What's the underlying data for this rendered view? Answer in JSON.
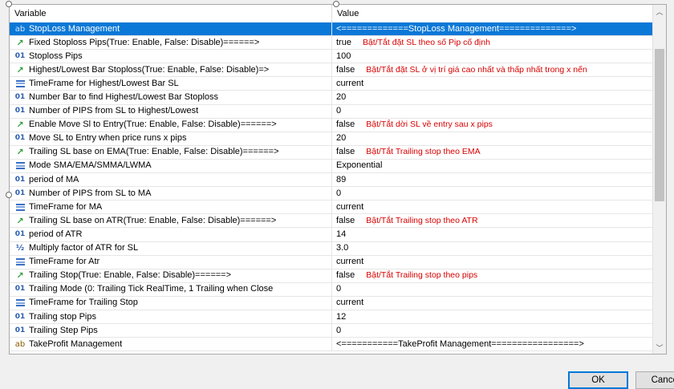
{
  "header": {
    "variable": "Variable",
    "value": "Value"
  },
  "rows": [
    {
      "type": "str",
      "name": "StopLoss Management",
      "value": "<=============StopLoss Management==============>",
      "note": "",
      "selected": true
    },
    {
      "type": "bool",
      "name": "Fixed Stoploss Pips(True: Enable, False: Disable)======>",
      "value": "true",
      "note": "Bật/Tắt đặt SL theo số Pip cố định"
    },
    {
      "type": "int",
      "name": "Stoploss Pips",
      "value": "100",
      "note": ""
    },
    {
      "type": "bool",
      "name": "Highest/Lowest Bar Stoploss(True: Enable, False: Disable)=>",
      "value": "false",
      "note": "Bật/Tắt đặt SL ở vị trí giá cao nhất và thấp nhất trong x nến"
    },
    {
      "type": "enum",
      "name": "TimeFrame for Highest/Lowest Bar SL",
      "value": "current",
      "note": ""
    },
    {
      "type": "int",
      "name": "Number Bar to find Highest/Lowest Bar Stoploss",
      "value": "20",
      "note": ""
    },
    {
      "type": "int",
      "name": "Number of PIPS from SL to Highest/Lowest",
      "value": "0",
      "note": ""
    },
    {
      "type": "bool",
      "name": "Enable Move Sl to Entry(True: Enable, False: Disable)======>",
      "value": "false",
      "note": "Bật/Tắt dời SL về entry sau x pips"
    },
    {
      "type": "int",
      "name": "Move SL to Entry when price runs x pips",
      "value": "20",
      "note": ""
    },
    {
      "type": "bool",
      "name": "Trailing SL base on EMA(True: Enable, False: Disable)======>",
      "value": "false",
      "note": "Bật/Tắt Trailing stop theo EMA"
    },
    {
      "type": "enum",
      "name": "Mode SMA/EMA/SMMA/LWMA",
      "value": "Exponential",
      "note": ""
    },
    {
      "type": "int",
      "name": "period of MA",
      "value": "89",
      "note": ""
    },
    {
      "type": "int",
      "name": "Number of PIPS from SL to MA",
      "value": "0",
      "note": ""
    },
    {
      "type": "enum",
      "name": "TimeFrame for MA",
      "value": "current",
      "note": ""
    },
    {
      "type": "bool",
      "name": "Trailing SL base on ATR(True: Enable, False: Disable)======>",
      "value": "false",
      "note": "Bật/Tắt Trailing stop theo ATR"
    },
    {
      "type": "int",
      "name": "period of ATR",
      "value": "14",
      "note": ""
    },
    {
      "type": "frac",
      "name": "Multiply factor of ATR for SL",
      "value": "3.0",
      "note": ""
    },
    {
      "type": "enum",
      "name": "TimeFrame for Atr",
      "value": "current",
      "note": ""
    },
    {
      "type": "bool",
      "name": "Trailing Stop(True: Enable, False: Disable)======>",
      "value": "false",
      "note": "Bật/Tắt Trailing stop theo pips"
    },
    {
      "type": "int",
      "name": "Trailing Mode (0: Trailing Tick RealTime, 1 Trailing when Close",
      "value": "0",
      "note": ""
    },
    {
      "type": "enum",
      "name": "TimeFrame for Trailing Stop",
      "value": "current",
      "note": ""
    },
    {
      "type": "int",
      "name": "Trailing stop Pips",
      "value": "12",
      "note": ""
    },
    {
      "type": "int",
      "name": "Trailing Step Pips",
      "value": "0",
      "note": ""
    },
    {
      "type": "str",
      "name": "TakeProfit Management",
      "value": "<===========TakeProfit Management=================>",
      "note": ""
    }
  ],
  "icons": {
    "int": "01",
    "bool": "↗",
    "str": "ab",
    "frac": "½",
    "enum": "enum-list-icon"
  },
  "buttons": {
    "ok": "OK",
    "cancel": "Cancel"
  },
  "colors": {
    "selection": "#0a78d7",
    "note": "#d80000"
  }
}
